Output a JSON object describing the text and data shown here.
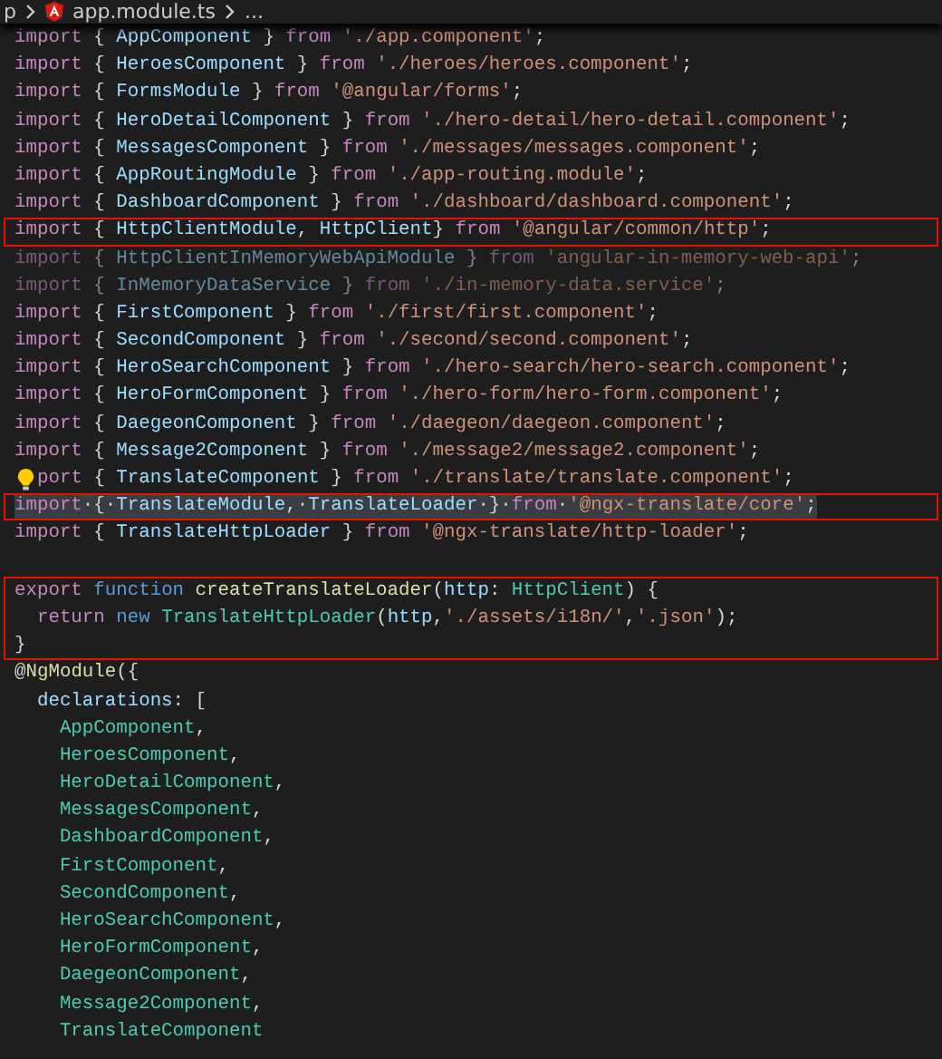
{
  "breadcrumb": [
    {
      "kind": "folder",
      "text": "p"
    },
    {
      "kind": "file",
      "text": "app.module.ts"
    },
    {
      "kind": "more",
      "text": "..."
    }
  ],
  "editor": {
    "blocks": [
      {
        "boxed": false,
        "blank_line_before": false,
        "lines": [
          {
            "faded": false,
            "selected": false,
            "lightbulb": false,
            "tokens": [
              {
                "kind": "keyword",
                "text": "import"
              },
              {
                "kind": "punct",
                "text": " { "
              },
              {
                "kind": "name",
                "text": "AppComponent"
              },
              {
                "kind": "punct",
                "text": " } "
              },
              {
                "kind": "keyword",
                "text": "from "
              },
              {
                "kind": "string",
                "text": "'./app.component'"
              },
              {
                "kind": "punct",
                "text": ";"
              }
            ]
          },
          {
            "faded": false,
            "selected": false,
            "lightbulb": false,
            "tokens": [
              {
                "kind": "keyword",
                "text": "import"
              },
              {
                "kind": "punct",
                "text": " { "
              },
              {
                "kind": "name",
                "text": "HeroesComponent"
              },
              {
                "kind": "punct",
                "text": " } "
              },
              {
                "kind": "keyword",
                "text": "from "
              },
              {
                "kind": "string",
                "text": "'./heroes/heroes.component'"
              },
              {
                "kind": "punct",
                "text": ";"
              }
            ]
          },
          {
            "faded": false,
            "selected": false,
            "lightbulb": false,
            "tokens": [
              {
                "kind": "keyword",
                "text": "import"
              },
              {
                "kind": "punct",
                "text": " { "
              },
              {
                "kind": "name",
                "text": "FormsModule"
              },
              {
                "kind": "punct",
                "text": " } "
              },
              {
                "kind": "keyword",
                "text": "from "
              },
              {
                "kind": "string",
                "text": "'@angular/forms'"
              },
              {
                "kind": "punct",
                "text": ";"
              }
            ]
          },
          {
            "faded": false,
            "selected": false,
            "lightbulb": false,
            "tokens": [
              {
                "kind": "keyword",
                "text": "import"
              },
              {
                "kind": "punct",
                "text": " { "
              },
              {
                "kind": "name",
                "text": "HeroDetailComponent"
              },
              {
                "kind": "punct",
                "text": " } "
              },
              {
                "kind": "keyword",
                "text": "from "
              },
              {
                "kind": "string",
                "text": "'./hero-detail/hero-detail.component'"
              },
              {
                "kind": "punct",
                "text": ";"
              }
            ]
          },
          {
            "faded": false,
            "selected": false,
            "lightbulb": false,
            "tokens": [
              {
                "kind": "keyword",
                "text": "import"
              },
              {
                "kind": "punct",
                "text": " { "
              },
              {
                "kind": "name",
                "text": "MessagesComponent"
              },
              {
                "kind": "punct",
                "text": " } "
              },
              {
                "kind": "keyword",
                "text": "from "
              },
              {
                "kind": "string",
                "text": "'./messages/messages.component'"
              },
              {
                "kind": "punct",
                "text": ";"
              }
            ]
          },
          {
            "faded": false,
            "selected": false,
            "lightbulb": false,
            "tokens": [
              {
                "kind": "keyword",
                "text": "import"
              },
              {
                "kind": "punct",
                "text": " { "
              },
              {
                "kind": "name",
                "text": "AppRoutingModule"
              },
              {
                "kind": "punct",
                "text": " } "
              },
              {
                "kind": "keyword",
                "text": "from "
              },
              {
                "kind": "string",
                "text": "'./app-routing.module'"
              },
              {
                "kind": "punct",
                "text": ";"
              }
            ]
          },
          {
            "faded": false,
            "selected": false,
            "lightbulb": false,
            "tokens": [
              {
                "kind": "keyword",
                "text": "import"
              },
              {
                "kind": "punct",
                "text": " { "
              },
              {
                "kind": "name",
                "text": "DashboardComponent"
              },
              {
                "kind": "punct",
                "text": " } "
              },
              {
                "kind": "keyword",
                "text": "from "
              },
              {
                "kind": "string",
                "text": "'./dashboard/dashboard.component'"
              },
              {
                "kind": "punct",
                "text": ";"
              }
            ]
          }
        ]
      },
      {
        "boxed": true,
        "blank_line_before": false,
        "lines": [
          {
            "faded": false,
            "selected": false,
            "lightbulb": false,
            "tokens": [
              {
                "kind": "keyword",
                "text": "import"
              },
              {
                "kind": "punct",
                "text": " { "
              },
              {
                "kind": "name",
                "text": "HttpClientModule"
              },
              {
                "kind": "punct",
                "text": ", "
              },
              {
                "kind": "name",
                "text": "HttpClient"
              },
              {
                "kind": "punct",
                "text": "} "
              },
              {
                "kind": "keyword",
                "text": "from "
              },
              {
                "kind": "string",
                "text": "'@angular/common/http'"
              },
              {
                "kind": "punct",
                "text": ";"
              }
            ]
          }
        ]
      },
      {
        "boxed": false,
        "blank_line_before": false,
        "lines": [
          {
            "faded": true,
            "selected": false,
            "lightbulb": false,
            "tokens": [
              {
                "kind": "keyword",
                "text": "import"
              },
              {
                "kind": "punct",
                "text": " { "
              },
              {
                "kind": "name",
                "text": "HttpClientInMemoryWebApiModule"
              },
              {
                "kind": "punct",
                "text": " } "
              },
              {
                "kind": "keyword",
                "text": "from "
              },
              {
                "kind": "string",
                "text": "'angular-in-memory-web-api'"
              },
              {
                "kind": "punct",
                "text": ";"
              }
            ]
          },
          {
            "faded": true,
            "selected": false,
            "lightbulb": false,
            "tokens": [
              {
                "kind": "keyword",
                "text": "import"
              },
              {
                "kind": "punct",
                "text": " { "
              },
              {
                "kind": "name",
                "text": "InMemoryDataService"
              },
              {
                "kind": "punct",
                "text": " } "
              },
              {
                "kind": "keyword",
                "text": "from "
              },
              {
                "kind": "string",
                "text": "'./in-memory-data.service'"
              },
              {
                "kind": "punct",
                "text": ";"
              }
            ]
          },
          {
            "faded": false,
            "selected": false,
            "lightbulb": false,
            "tokens": [
              {
                "kind": "keyword",
                "text": "import"
              },
              {
                "kind": "punct",
                "text": " { "
              },
              {
                "kind": "name",
                "text": "FirstComponent"
              },
              {
                "kind": "punct",
                "text": " } "
              },
              {
                "kind": "keyword",
                "text": "from "
              },
              {
                "kind": "string",
                "text": "'./first/first.component'"
              },
              {
                "kind": "punct",
                "text": ";"
              }
            ]
          },
          {
            "faded": false,
            "selected": false,
            "lightbulb": false,
            "tokens": [
              {
                "kind": "keyword",
                "text": "import"
              },
              {
                "kind": "punct",
                "text": " { "
              },
              {
                "kind": "name",
                "text": "SecondComponent"
              },
              {
                "kind": "punct",
                "text": " } "
              },
              {
                "kind": "keyword",
                "text": "from "
              },
              {
                "kind": "string",
                "text": "'./second/second.component'"
              },
              {
                "kind": "punct",
                "text": ";"
              }
            ]
          },
          {
            "faded": false,
            "selected": false,
            "lightbulb": false,
            "tokens": [
              {
                "kind": "keyword",
                "text": "import"
              },
              {
                "kind": "punct",
                "text": " { "
              },
              {
                "kind": "name",
                "text": "HeroSearchComponent"
              },
              {
                "kind": "punct",
                "text": " } "
              },
              {
                "kind": "keyword",
                "text": "from "
              },
              {
                "kind": "string",
                "text": "'./hero-search/hero-search.component'"
              },
              {
                "kind": "punct",
                "text": ";"
              }
            ]
          },
          {
            "faded": false,
            "selected": false,
            "lightbulb": false,
            "tokens": [
              {
                "kind": "keyword",
                "text": "import"
              },
              {
                "kind": "punct",
                "text": " { "
              },
              {
                "kind": "name",
                "text": "HeroFormComponent"
              },
              {
                "kind": "punct",
                "text": " } "
              },
              {
                "kind": "keyword",
                "text": "from "
              },
              {
                "kind": "string",
                "text": "'./hero-form/hero-form.component'"
              },
              {
                "kind": "punct",
                "text": ";"
              }
            ]
          },
          {
            "faded": false,
            "selected": false,
            "lightbulb": false,
            "tokens": [
              {
                "kind": "keyword",
                "text": "import"
              },
              {
                "kind": "punct",
                "text": " { "
              },
              {
                "kind": "name",
                "text": "DaegeonComponent"
              },
              {
                "kind": "punct",
                "text": " } "
              },
              {
                "kind": "keyword",
                "text": "from "
              },
              {
                "kind": "string",
                "text": "'./daegeon/daegeon.component'"
              },
              {
                "kind": "punct",
                "text": ";"
              }
            ]
          },
          {
            "faded": false,
            "selected": false,
            "lightbulb": false,
            "tokens": [
              {
                "kind": "keyword",
                "text": "import"
              },
              {
                "kind": "punct",
                "text": " { "
              },
              {
                "kind": "name",
                "text": "Message2Component"
              },
              {
                "kind": "punct",
                "text": " } "
              },
              {
                "kind": "keyword",
                "text": "from "
              },
              {
                "kind": "string",
                "text": "'./message2/message2.component'"
              },
              {
                "kind": "punct",
                "text": ";"
              }
            ]
          },
          {
            "faded": false,
            "selected": false,
            "lightbulb": true,
            "tokens": [
              {
                "kind": "keyword",
                "text": "port"
              },
              {
                "kind": "punct",
                "text": " { "
              },
              {
                "kind": "name",
                "text": "TranslateComponent"
              },
              {
                "kind": "punct",
                "text": " } "
              },
              {
                "kind": "keyword",
                "text": "from "
              },
              {
                "kind": "string",
                "text": "'./translate/translate.component'"
              },
              {
                "kind": "punct",
                "text": ";"
              }
            ]
          }
        ]
      },
      {
        "boxed": true,
        "blank_line_before": false,
        "lines": [
          {
            "faded": false,
            "selected": true,
            "lightbulb": false,
            "tokens": [
              {
                "kind": "keyword",
                "text": "import"
              },
              {
                "kind": "punct",
                "text": "·{·"
              },
              {
                "kind": "name",
                "text": "TranslateModule"
              },
              {
                "kind": "punct",
                "text": ",·"
              },
              {
                "kind": "name",
                "text": "TranslateLoader"
              },
              {
                "kind": "punct",
                "text": "·}·"
              },
              {
                "kind": "keyword",
                "text": "from"
              },
              {
                "kind": "punct",
                "text": "·"
              },
              {
                "kind": "string",
                "text": "'@ngx-translate/core'"
              },
              {
                "kind": "punct",
                "text": ";"
              }
            ]
          }
        ]
      },
      {
        "boxed": false,
        "blank_line_before": false,
        "lines": [
          {
            "faded": false,
            "selected": false,
            "lightbulb": false,
            "tokens": [
              {
                "kind": "keyword",
                "text": "import"
              },
              {
                "kind": "punct",
                "text": " { "
              },
              {
                "kind": "name",
                "text": "TranslateHttpLoader"
              },
              {
                "kind": "punct",
                "text": " } "
              },
              {
                "kind": "keyword",
                "text": "from "
              },
              {
                "kind": "string",
                "text": "'@ngx-translate/http-loader'"
              },
              {
                "kind": "punct",
                "text": ";"
              }
            ]
          }
        ]
      },
      {
        "boxed": true,
        "blank_line_before": true,
        "lines": [
          {
            "faded": false,
            "selected": false,
            "lightbulb": false,
            "tokens": [
              {
                "kind": "keyword",
                "text": "export "
              },
              {
                "kind": "storage",
                "text": "function "
              },
              {
                "kind": "func",
                "text": "createTranslateLoader"
              },
              {
                "kind": "punct",
                "text": "("
              },
              {
                "kind": "name",
                "text": "http"
              },
              {
                "kind": "punct",
                "text": ": "
              },
              {
                "kind": "type",
                "text": "HttpClient"
              },
              {
                "kind": "punct",
                "text": ") {"
              }
            ]
          },
          {
            "faded": false,
            "selected": false,
            "lightbulb": false,
            "tokens": [
              {
                "kind": "keyword",
                "text": "  return "
              },
              {
                "kind": "storage",
                "text": "new "
              },
              {
                "kind": "type",
                "text": "TranslateHttpLoader"
              },
              {
                "kind": "punct",
                "text": "("
              },
              {
                "kind": "name",
                "text": "http"
              },
              {
                "kind": "punct",
                "text": ","
              },
              {
                "kind": "string",
                "text": "'./assets/i18n/'"
              },
              {
                "kind": "punct",
                "text": ","
              },
              {
                "kind": "string",
                "text": "'.json'"
              },
              {
                "kind": "punct",
                "text": ");"
              }
            ]
          },
          {
            "faded": false,
            "selected": false,
            "lightbulb": false,
            "tokens": [
              {
                "kind": "punct",
                "text": "}"
              }
            ]
          }
        ]
      },
      {
        "boxed": false,
        "blank_line_before": false,
        "lines": [
          {
            "faded": false,
            "selected": false,
            "lightbulb": false,
            "tokens": [
              {
                "kind": "punct",
                "text": "@"
              },
              {
                "kind": "func",
                "text": "NgModule"
              },
              {
                "kind": "punct",
                "text": "({"
              }
            ]
          },
          {
            "faded": false,
            "selected": false,
            "lightbulb": false,
            "tokens": [
              {
                "kind": "name",
                "text": "  declarations"
              },
              {
                "kind": "punct",
                "text": ": ["
              }
            ]
          },
          {
            "faded": false,
            "selected": false,
            "lightbulb": false,
            "tokens": [
              {
                "kind": "type",
                "text": "    AppComponent"
              },
              {
                "kind": "punct",
                "text": ","
              }
            ]
          },
          {
            "faded": false,
            "selected": false,
            "lightbulb": false,
            "tokens": [
              {
                "kind": "type",
                "text": "    HeroesComponent"
              },
              {
                "kind": "punct",
                "text": ","
              }
            ]
          },
          {
            "faded": false,
            "selected": false,
            "lightbulb": false,
            "tokens": [
              {
                "kind": "type",
                "text": "    HeroDetailComponent"
              },
              {
                "kind": "punct",
                "text": ","
              }
            ]
          },
          {
            "faded": false,
            "selected": false,
            "lightbulb": false,
            "tokens": [
              {
                "kind": "type",
                "text": "    MessagesComponent"
              },
              {
                "kind": "punct",
                "text": ","
              }
            ]
          },
          {
            "faded": false,
            "selected": false,
            "lightbulb": false,
            "tokens": [
              {
                "kind": "type",
                "text": "    DashboardComponent"
              },
              {
                "kind": "punct",
                "text": ","
              }
            ]
          },
          {
            "faded": false,
            "selected": false,
            "lightbulb": false,
            "tokens": [
              {
                "kind": "type",
                "text": "    FirstComponent"
              },
              {
                "kind": "punct",
                "text": ","
              }
            ]
          },
          {
            "faded": false,
            "selected": false,
            "lightbulb": false,
            "tokens": [
              {
                "kind": "type",
                "text": "    SecondComponent"
              },
              {
                "kind": "punct",
                "text": ","
              }
            ]
          },
          {
            "faded": false,
            "selected": false,
            "lightbulb": false,
            "tokens": [
              {
                "kind": "type",
                "text": "    HeroSearchComponent"
              },
              {
                "kind": "punct",
                "text": ","
              }
            ]
          },
          {
            "faded": false,
            "selected": false,
            "lightbulb": false,
            "tokens": [
              {
                "kind": "type",
                "text": "    HeroFormComponent"
              },
              {
                "kind": "punct",
                "text": ","
              }
            ]
          },
          {
            "faded": false,
            "selected": false,
            "lightbulb": false,
            "tokens": [
              {
                "kind": "type",
                "text": "    DaegeonComponent"
              },
              {
                "kind": "punct",
                "text": ","
              }
            ]
          },
          {
            "faded": false,
            "selected": false,
            "lightbulb": false,
            "tokens": [
              {
                "kind": "type",
                "text": "    Message2Component"
              },
              {
                "kind": "punct",
                "text": ","
              }
            ]
          },
          {
            "faded": false,
            "selected": false,
            "lightbulb": false,
            "tokens": [
              {
                "kind": "type",
                "text": "    TranslateComponent"
              }
            ]
          }
        ]
      }
    ]
  }
}
